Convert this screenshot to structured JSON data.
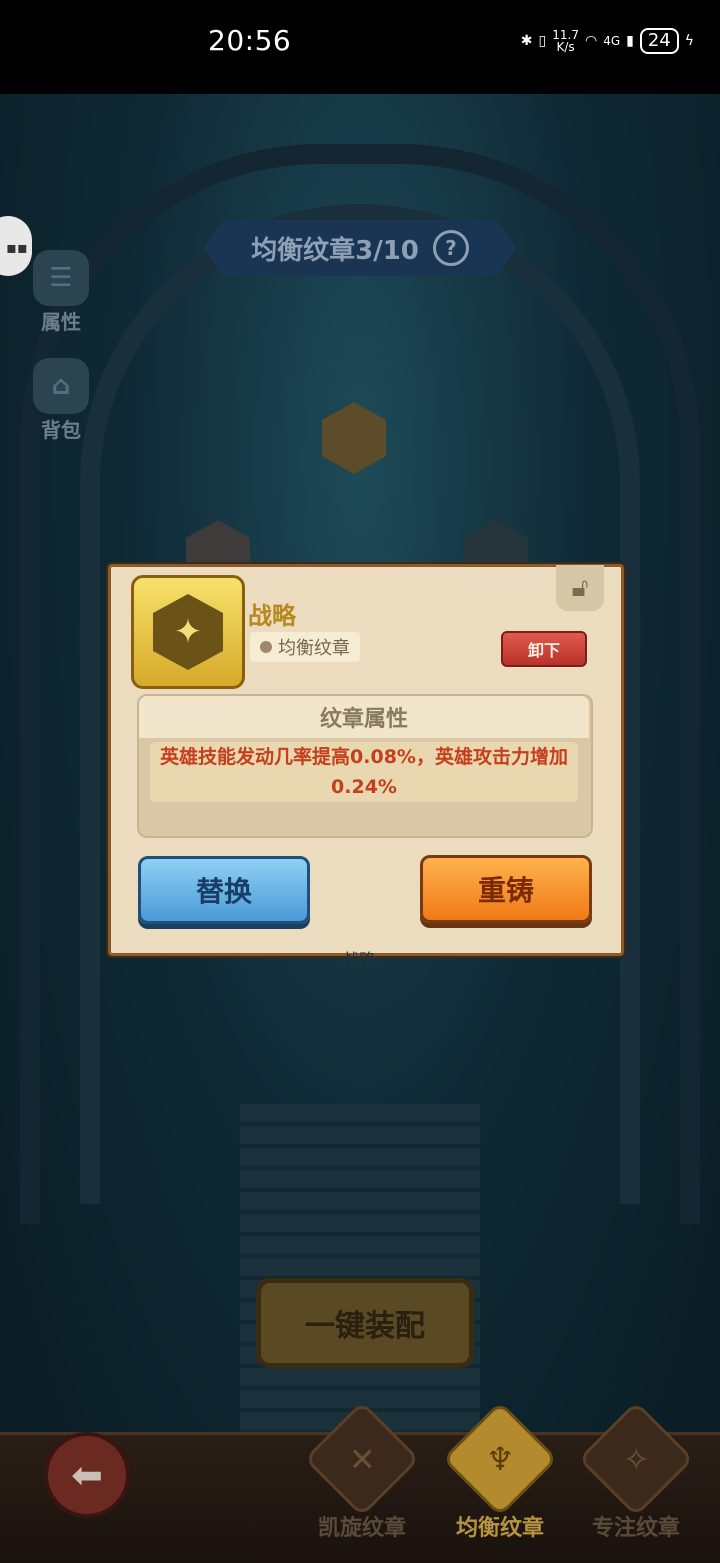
{
  "status_bar": {
    "time": "20:56",
    "net_speed": "11.7\nK/s",
    "signal_label": "4G",
    "battery": "24",
    "icons": [
      "bluetooth-icon",
      "vibrate-icon",
      "wifi-icon",
      "signal-icon",
      "battery-icon",
      "charging-icon"
    ]
  },
  "header": {
    "title": "均衡纹章3/10",
    "help_glyph": "?"
  },
  "side": {
    "attributes_label": "属性",
    "bag_label": "背包"
  },
  "popup": {
    "emblem_name": "战略",
    "emblem_type": "均衡纹章",
    "unequip_label": "卸下",
    "attr_title": "纹章属性",
    "attr_desc": "英雄技能发动几率提高0.08%，英雄攻击力增加0.24%",
    "replace_label": "替换",
    "reforge_label": "重铸"
  },
  "slot_label": "战略",
  "equip_all_label": "一键装配",
  "tabs": [
    {
      "label": "凯旋纹章",
      "selected": false
    },
    {
      "label": "均衡纹章",
      "selected": true
    },
    {
      "label": "专注纹章",
      "selected": false
    }
  ],
  "colors": {
    "accent_gold": "#b8881e",
    "danger_red": "#c4401c",
    "replace_blue": "#4a9ad6",
    "reforge_orange": "#ef7a17"
  }
}
